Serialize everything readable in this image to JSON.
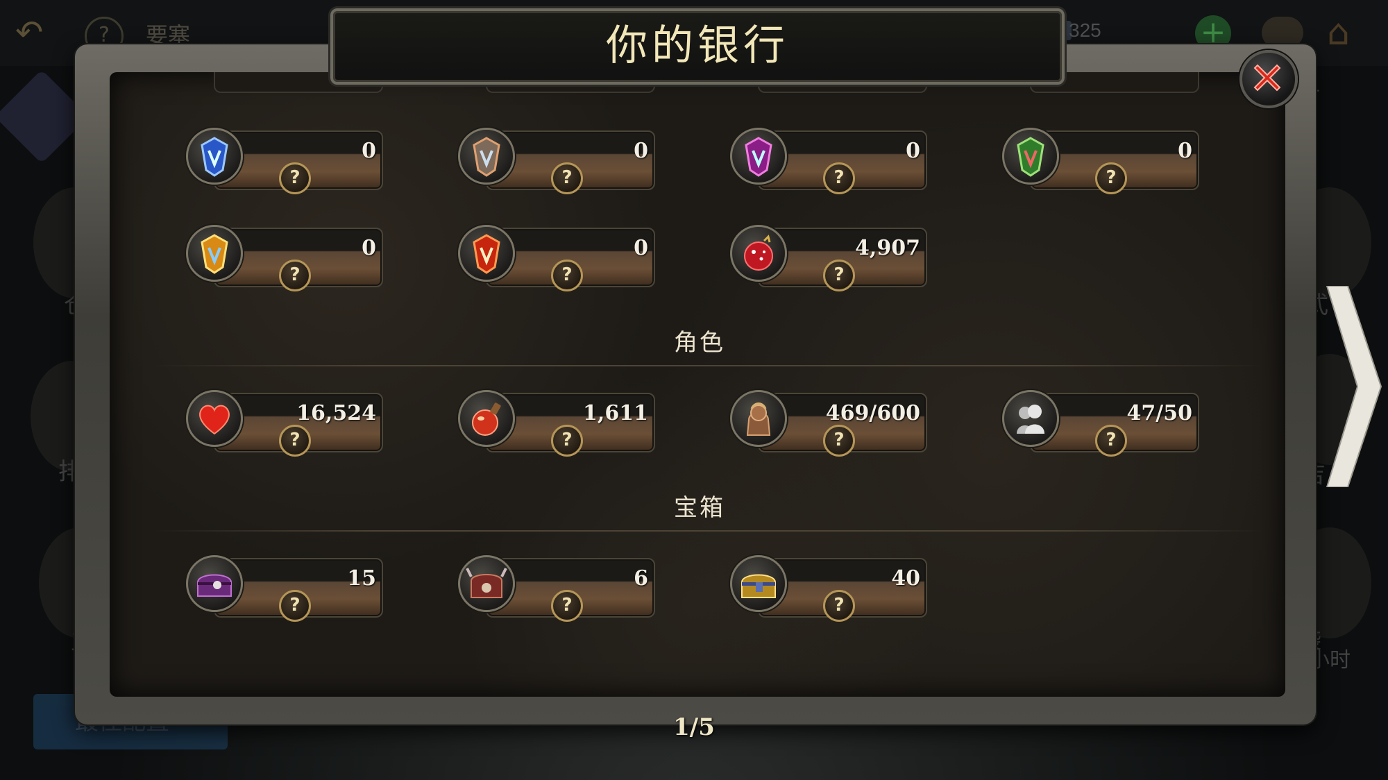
{
  "background": {
    "back_label": "↶",
    "help_label": "?",
    "location": "要塞",
    "currency_value": "325",
    "plus_label": "+",
    "side_labels": [
      "仓",
      "排行",
      "工",
      "式",
      "吉",
      "袭",
      "小时",
      "时"
    ],
    "bottom_button": "最佳配置"
  },
  "modal": {
    "title": "你的银行",
    "close_label": "close",
    "help_mark": "?",
    "pager": "1/5"
  },
  "sections": {
    "characters_title": "角色",
    "chests_title": "宝箱"
  },
  "shards_row1": [
    {
      "icon": "blue-shard-icon",
      "value": "0"
    },
    {
      "icon": "orange-shard-icon",
      "value": "0"
    },
    {
      "icon": "purple-shard-icon",
      "value": "0"
    },
    {
      "icon": "green-shard-icon",
      "value": "0"
    }
  ],
  "shards_row2": [
    {
      "icon": "gold-shard-icon",
      "value": "0"
    },
    {
      "icon": "red-shard-icon",
      "value": "0"
    },
    {
      "icon": "red-orb-icon",
      "value": "4,907"
    }
  ],
  "characters": [
    {
      "icon": "heart-icon",
      "value": "16,524"
    },
    {
      "icon": "potion-icon",
      "value": "1,611"
    },
    {
      "icon": "hero-bust-icon",
      "value": "469/600"
    },
    {
      "icon": "silhouette-icon",
      "value": "47/50"
    }
  ],
  "chests": [
    {
      "icon": "purple-chest-icon",
      "value": "15"
    },
    {
      "icon": "red-chest-icon",
      "value": "6"
    },
    {
      "icon": "gold-chest-icon",
      "value": "40"
    }
  ],
  "colors": {
    "title_text": "#f2e7b8",
    "value_text": "#f3efe4",
    "close_red": "#d0261c",
    "help_border": "#b59657"
  }
}
